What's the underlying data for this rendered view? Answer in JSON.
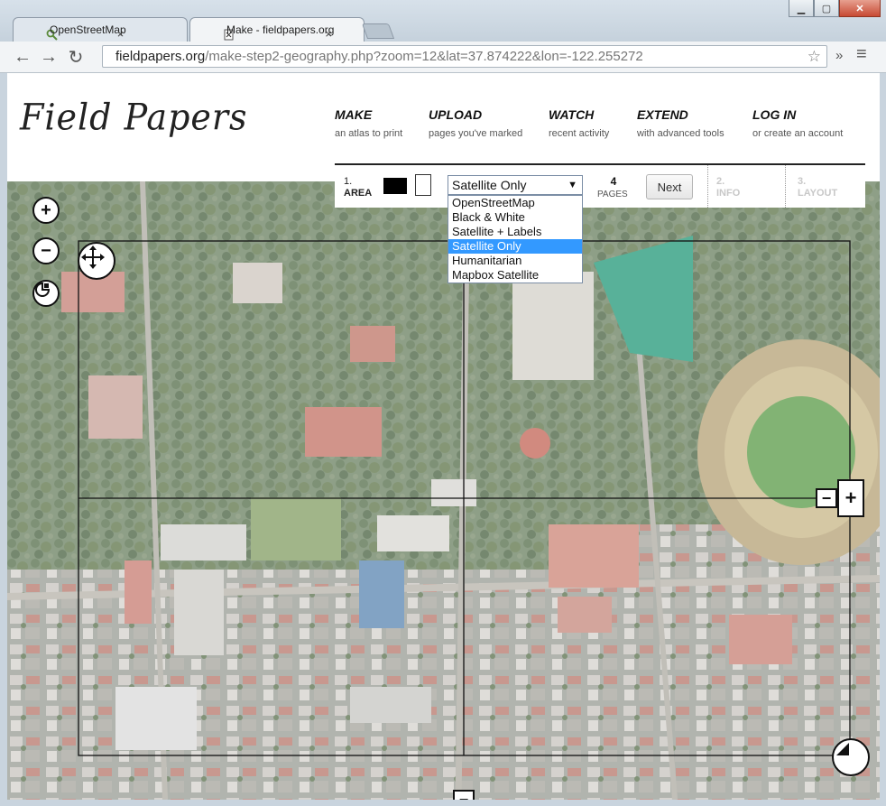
{
  "browser": {
    "tabs": [
      {
        "title": "OpenStreetMap",
        "favicon": "magnifier-icon"
      },
      {
        "title": "Make - fieldpapers.org",
        "favicon": "page-icon"
      }
    ],
    "close_glyph": "×",
    "url_host": "fieldpapers.org",
    "url_path": "/make-step2-geography.php?zoom=12&lat=37.874222&lon=-122.255272",
    "icons": {
      "back": "←",
      "forward": "→",
      "reload": "↻",
      "star": "☆",
      "overflow": "»",
      "menu": "≡"
    }
  },
  "site": {
    "logo": "Field Papers",
    "nav": [
      {
        "title": "MAKE",
        "sub": "an atlas to print"
      },
      {
        "title": "UPLOAD",
        "sub": "pages you've marked"
      },
      {
        "title": "WATCH",
        "sub": "recent activity"
      },
      {
        "title": "EXTEND",
        "sub": "with advanced tools"
      },
      {
        "title": "LOG IN",
        "sub": "or create an account"
      }
    ]
  },
  "steps": {
    "area_num": "1.",
    "area_label": "AREA",
    "selected_layer": "Satellite Only",
    "layer_options": [
      "OpenStreetMap",
      "Black & White",
      "Satellite + Labels",
      "Satellite Only",
      "Humanitarian",
      "Mapbox Satellite"
    ],
    "page_count": "4",
    "pages_label": "PAGES",
    "next_label": "Next",
    "info_num": "2.",
    "info_label": "INFO",
    "layout_num": "3.",
    "layout_label": "LAYOUT"
  },
  "map_controls": {
    "zoom_in": "+",
    "zoom_out": "−",
    "add_col": "+",
    "remove_col": "−",
    "add_row": "+",
    "remove_row": "−"
  }
}
